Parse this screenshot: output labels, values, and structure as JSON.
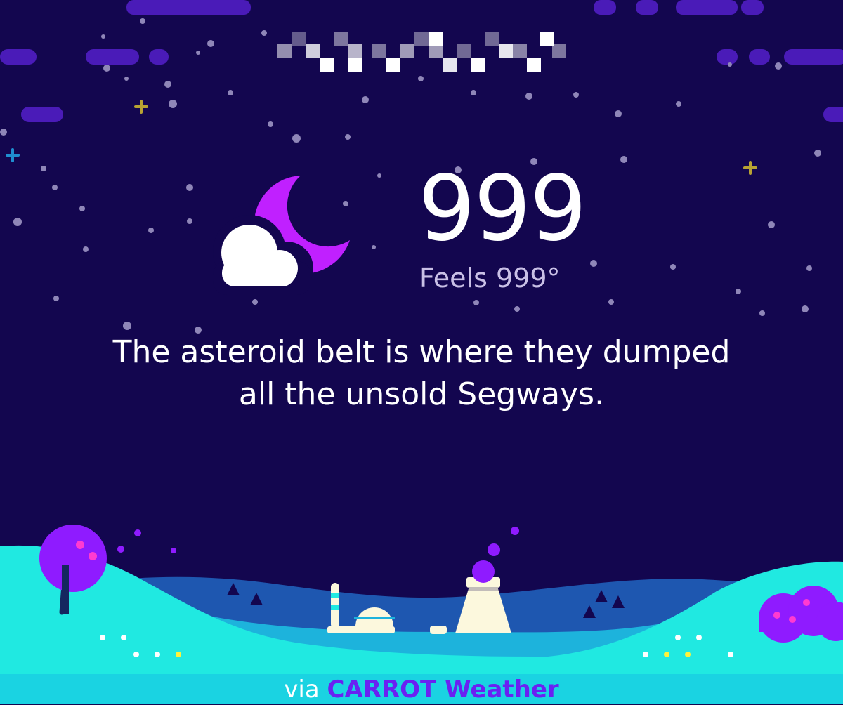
{
  "header": {
    "location_text": ""
  },
  "weather": {
    "condition_icon": "partly-cloudy-night-icon",
    "temperature": "999",
    "feels_like": "Feels 999°",
    "message": "The asteroid belt is where they dumped all the unsold Segways."
  },
  "footer": {
    "via_label": "via",
    "brand_label": "CARROT Weather"
  },
  "colors": {
    "background": "#13064f",
    "moon": "#c020ff",
    "cloud": "#ffffff",
    "hill_front": "#20e9e1",
    "hill_back": "#1db3dc",
    "hill_far": "#1e57b0",
    "footer_bg": "#1ad3e2",
    "brand": "#6a21f2",
    "banner": "#4a1bb8"
  }
}
